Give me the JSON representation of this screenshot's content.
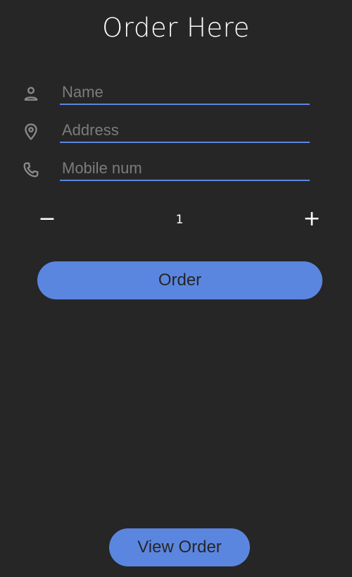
{
  "page": {
    "title": "Order Here"
  },
  "form": {
    "fields": [
      {
        "icon": "person-icon",
        "placeholder": "Name",
        "value": ""
      },
      {
        "icon": "location-pin-icon",
        "placeholder": "Address",
        "value": ""
      },
      {
        "icon": "phone-icon",
        "placeholder": "Mobile num",
        "value": ""
      }
    ]
  },
  "quantity": {
    "minus_label": "−",
    "value": "1",
    "plus_label": "+"
  },
  "actions": {
    "order_label": "Order",
    "view_order_label": "View Order"
  },
  "colors": {
    "background": "#262626",
    "accent": "#5b86e0",
    "icon": "#8a8a8a",
    "placeholder": "#7c7c7c",
    "button_text": "#262626"
  }
}
